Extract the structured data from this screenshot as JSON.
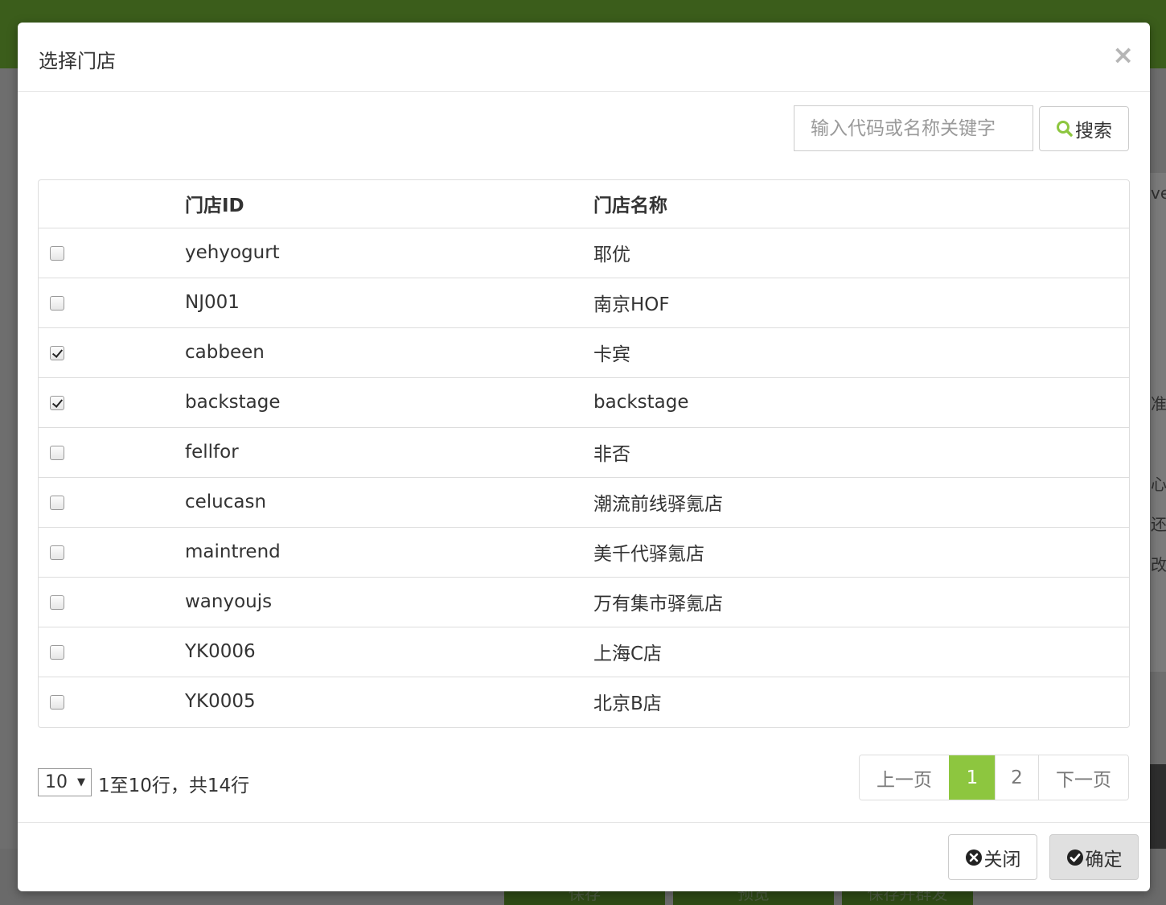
{
  "background": {
    "side_fragments": [
      "ve",
      "准",
      "心",
      "还",
      "改"
    ],
    "bottom_buttons": [
      "保存",
      "预览",
      "保存并群发"
    ]
  },
  "modal": {
    "title": "选择门店",
    "close_symbol": "×"
  },
  "search": {
    "placeholder": "输入代码或名称关键字",
    "button_label": "搜索",
    "icon": "search-icon"
  },
  "table": {
    "headers": [
      "",
      "门店ID",
      "门店名称"
    ],
    "rows": [
      {
        "checked": false,
        "id": "yehyogurt",
        "name": "耶优"
      },
      {
        "checked": false,
        "id": "NJ001",
        "name": "南京HOF"
      },
      {
        "checked": true,
        "id": "cabbeen",
        "name": "卡宾"
      },
      {
        "checked": true,
        "id": "backstage",
        "name": "backstage"
      },
      {
        "checked": false,
        "id": "fellfor",
        "name": "非否"
      },
      {
        "checked": false,
        "id": "celucasn",
        "name": "潮流前线驿氪店"
      },
      {
        "checked": false,
        "id": "maintrend",
        "name": "美千代驿氪店"
      },
      {
        "checked": false,
        "id": "wanyoujs",
        "name": "万有集市驿氪店"
      },
      {
        "checked": false,
        "id": "YK0006",
        "name": "上海C店"
      },
      {
        "checked": false,
        "id": "YK0005",
        "name": "北京B店"
      }
    ]
  },
  "pagination": {
    "page_size": "10",
    "info": "1至10行，共14行",
    "prev": "上一页",
    "pages": [
      "1",
      "2"
    ],
    "current_page": "1",
    "next": "下一页"
  },
  "footer": {
    "close_label": "关闭",
    "confirm_label": "确定",
    "close_icon": "times-circle-icon",
    "confirm_icon": "check-circle-icon"
  },
  "colors": {
    "accent": "#8dc63f",
    "header_bar": "#3b5d1b"
  }
}
